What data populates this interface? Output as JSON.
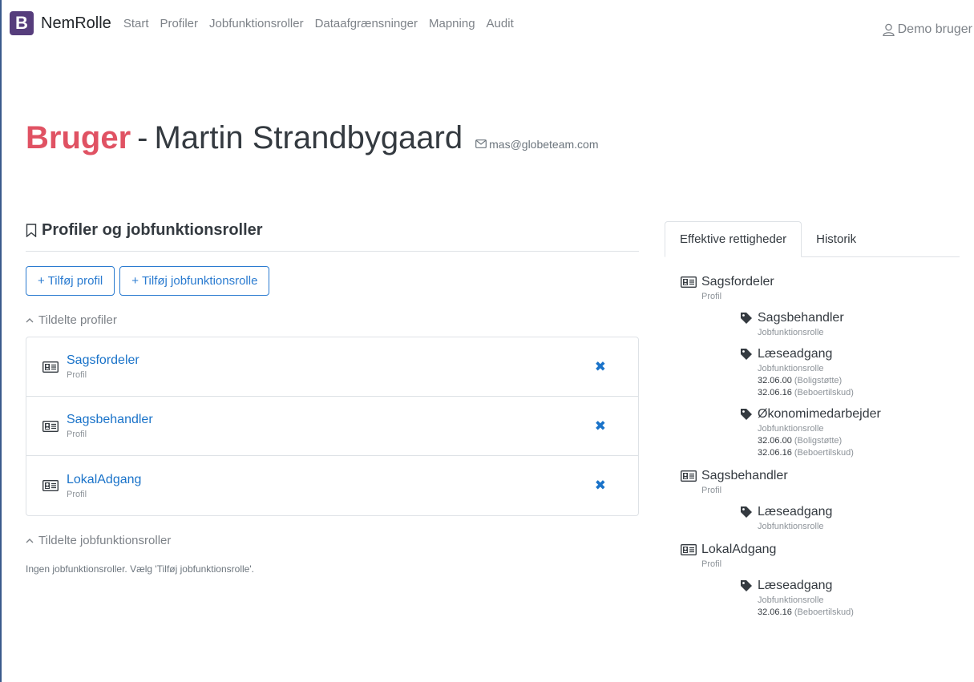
{
  "navbar": {
    "logo_letter": "B",
    "brand": "NemRolle",
    "links": [
      "Start",
      "Profiler",
      "Jobfunktionsroller",
      "Dataafgrænsninger",
      "Mapning",
      "Audit"
    ],
    "user": "Demo bruger"
  },
  "header": {
    "prefix": "Bruger",
    "separator": "-",
    "name": "Martin Strandbygaard",
    "email": "mas@globeteam.com"
  },
  "section": {
    "title": "Profiler og jobfunktionsroller",
    "add_profile_button": "+ Tilføj profil",
    "add_role_button": "+ Tilføj jobfunktionsrolle",
    "assigned_profiles_heading": "Tildelte profiler",
    "assigned_profiles": [
      {
        "name": "Sagsfordeler",
        "type": "Profil"
      },
      {
        "name": "Sagsbehandler",
        "type": "Profil"
      },
      {
        "name": "LokalAdgang",
        "type": "Profil"
      }
    ],
    "assigned_roles_heading": "Tildelte jobfunktionsroller",
    "no_roles_message": "Ingen jobfunktionsroller. Vælg 'Tilføj jobfunktionsrolle'."
  },
  "tabs": [
    "Effektive rettigheder",
    "Historik"
  ],
  "effective_rights": [
    {
      "name": "Sagsfordeler",
      "type": "Profil",
      "roles": [
        {
          "name": "Sagsbehandler",
          "type": "Jobfunktionsrolle",
          "codes": []
        },
        {
          "name": "Læseadgang",
          "type": "Jobfunktionsrolle",
          "codes": [
            {
              "code": "32.06.00",
              "desc": "(Boligstøtte)"
            },
            {
              "code": "32.06.16",
              "desc": "(Beboertilskud)"
            }
          ]
        },
        {
          "name": "Økonomimedarbejder",
          "type": "Jobfunktionsrolle",
          "codes": [
            {
              "code": "32.06.00",
              "desc": "(Boligstøtte)"
            },
            {
              "code": "32.06.16",
              "desc": "(Beboertilskud)"
            }
          ]
        }
      ]
    },
    {
      "name": "Sagsbehandler",
      "type": "Profil",
      "roles": [
        {
          "name": "Læseadgang",
          "type": "Jobfunktionsrolle",
          "codes": []
        }
      ]
    },
    {
      "name": "LokalAdgang",
      "type": "Profil",
      "roles": [
        {
          "name": "Læseadgang",
          "type": "Jobfunktionsrolle",
          "codes": [
            {
              "code": "32.06.16",
              "desc": "(Beboertilskud)"
            }
          ]
        }
      ]
    }
  ]
}
